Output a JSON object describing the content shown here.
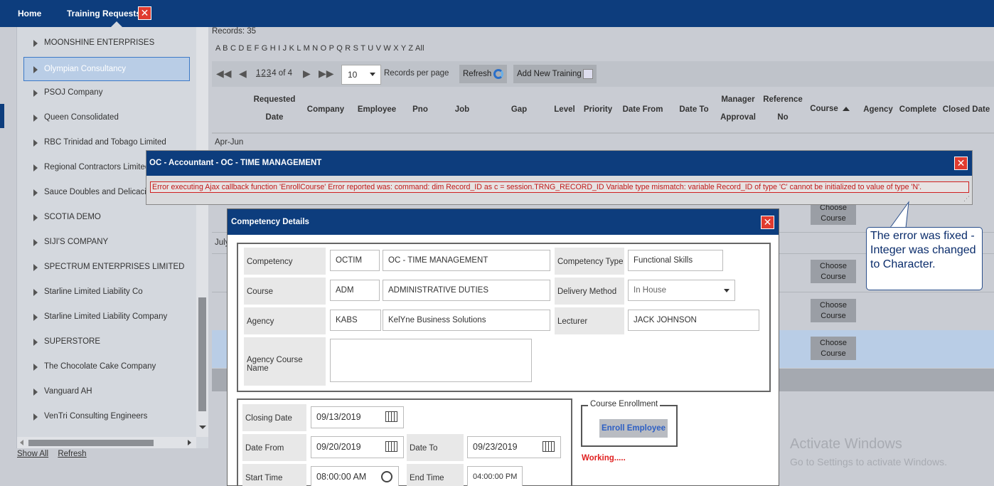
{
  "topbar": {
    "home": "Home",
    "training_requests": "Training Requests",
    "close": "✕"
  },
  "left_list": {
    "items": [
      "MOONSHINE ENTERPRISES",
      "Olympian Consultancy",
      "PSOJ Company",
      "Queen Consolidated",
      "RBC Trinidad and Tobago Limited",
      "Regional Contractors Limited",
      "Sauce Doubles and Delicacies",
      "SCOTIA DEMO",
      "SIJI'S COMPANY",
      "SPECTRUM ENTERPRISES LIMITED",
      "Starline Limited Liability Co",
      "Starline Limited Liability Company",
      "SUPERSTORE",
      "The Chocolate Cake Company",
      "Vanguard AH",
      "VenTri Consulting Engineers"
    ],
    "selected": "Olympian Consultancy",
    "show_all": "Show All",
    "refresh": "Refresh"
  },
  "main": {
    "records": "Records:  35",
    "alphabet": "A B C D E F G H I J K L M N O P Q R S T U V W X Y Z All",
    "pager": {
      "pages": [
        "1",
        "2",
        "3"
      ],
      "current": "4 of 4",
      "page_size": "10",
      "records_per_page": "Records per page",
      "refresh": "Refresh",
      "add_new": "Add New Training"
    },
    "columns": {
      "requested_date_1": "Requested",
      "requested_date_2": "Date",
      "company": "Company",
      "employee": "Employee",
      "pno": "Pno",
      "job": "Job",
      "gap": "Gap",
      "level": "Level",
      "priority": "Priority",
      "date_from": "Date From",
      "date_to": "Date To",
      "manager_approval_1": "Manager",
      "manager_approval_2": "Approval",
      "reference_no_1": "Reference",
      "reference_no_2": "No",
      "course": "Course",
      "agency": "Agency",
      "complete": "Complete",
      "closed_date": "Closed Date"
    },
    "groups": {
      "g1": "Apr-Jun",
      "g2": "July"
    },
    "choose_course": [
      "Choose",
      "Course"
    ]
  },
  "error_dialog": {
    "title": "OC - Accountant - OC - TIME MANAGEMENT",
    "message": "Error executing Ajax callback function 'EnrollCourse' Error reported was: command: dim Record_ID as c = session.TRNG_RECORD_ID Variable type mismatch: variable Record_ID of type 'C' cannot be initialized to value of type 'N'."
  },
  "competency_dialog": {
    "title": "Competency Details",
    "labels": {
      "competency": "Competency",
      "course": "Course",
      "agency": "Agency",
      "agency_course_name": "Agency Course Name",
      "competency_type": "Competency Type",
      "delivery_method": "Delivery Method",
      "lecturer": "Lecturer",
      "closing_date": "Closing Date",
      "date_from": "Date From",
      "date_to": "Date To",
      "start_time": "Start Time",
      "end_time": "End Time"
    },
    "values": {
      "competency_code": "OCTIM",
      "competency_name": "OC - TIME MANAGEMENT",
      "course_code": "ADM",
      "course_name": "ADMINISTRATIVE DUTIES",
      "agency_code": "KABS",
      "agency_name": "KelYne Business Solutions",
      "competency_type": "Functional Skills",
      "delivery_method": "In House",
      "lecturer": "JACK JOHNSON",
      "closing_date": "09/13/2019",
      "date_from": "09/20/2019",
      "date_to": "09/23/2019",
      "start_time": "08:00:00 AM",
      "end_time": "04:00:00 PM"
    },
    "enrollment_legend": "Course Enrollment",
    "enroll_button": "Enroll Employee",
    "working": "Working....."
  },
  "callout": "The error was fixed - Integer was changed to Character.",
  "watermark": {
    "line1": "Activate Windows",
    "line2": "Go to Settings to activate Windows."
  },
  "colors": {
    "header": "#0d3d7d",
    "close": "#e03b2f",
    "error": "#c01818",
    "selected_row": "#b9cde6"
  }
}
